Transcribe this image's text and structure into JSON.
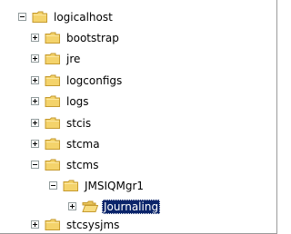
{
  "colors": {
    "folder_body": "#f4d36b",
    "folder_edge": "#c59a2e",
    "selection": "#0a246a",
    "expander_border": "#919b9c"
  },
  "tree": {
    "nodes": [
      {
        "label": "logicalhost",
        "expander": "expanded",
        "icon": "folder-icon"
      },
      {
        "label": "bootstrap",
        "expander": "collapsed",
        "icon": "folder-icon"
      },
      {
        "label": "jre",
        "expander": "collapsed",
        "icon": "folder-icon"
      },
      {
        "label": "logconfigs",
        "expander": "collapsed",
        "icon": "folder-icon"
      },
      {
        "label": "logs",
        "expander": "collapsed",
        "icon": "folder-icon"
      },
      {
        "label": "stcis",
        "expander": "collapsed",
        "icon": "folder-icon"
      },
      {
        "label": "stcma",
        "expander": "collapsed",
        "icon": "folder-icon"
      },
      {
        "label": "stcms",
        "expander": "expanded",
        "icon": "folder-icon"
      },
      {
        "label": "JMSIQMgr1",
        "expander": "expanded",
        "icon": "folder-icon"
      },
      {
        "label": "Journaling",
        "expander": "collapsed",
        "icon": "open-folder-icon",
        "selected": true
      },
      {
        "label": "stcsysjms",
        "expander": "collapsed",
        "icon": "folder-icon"
      }
    ]
  }
}
